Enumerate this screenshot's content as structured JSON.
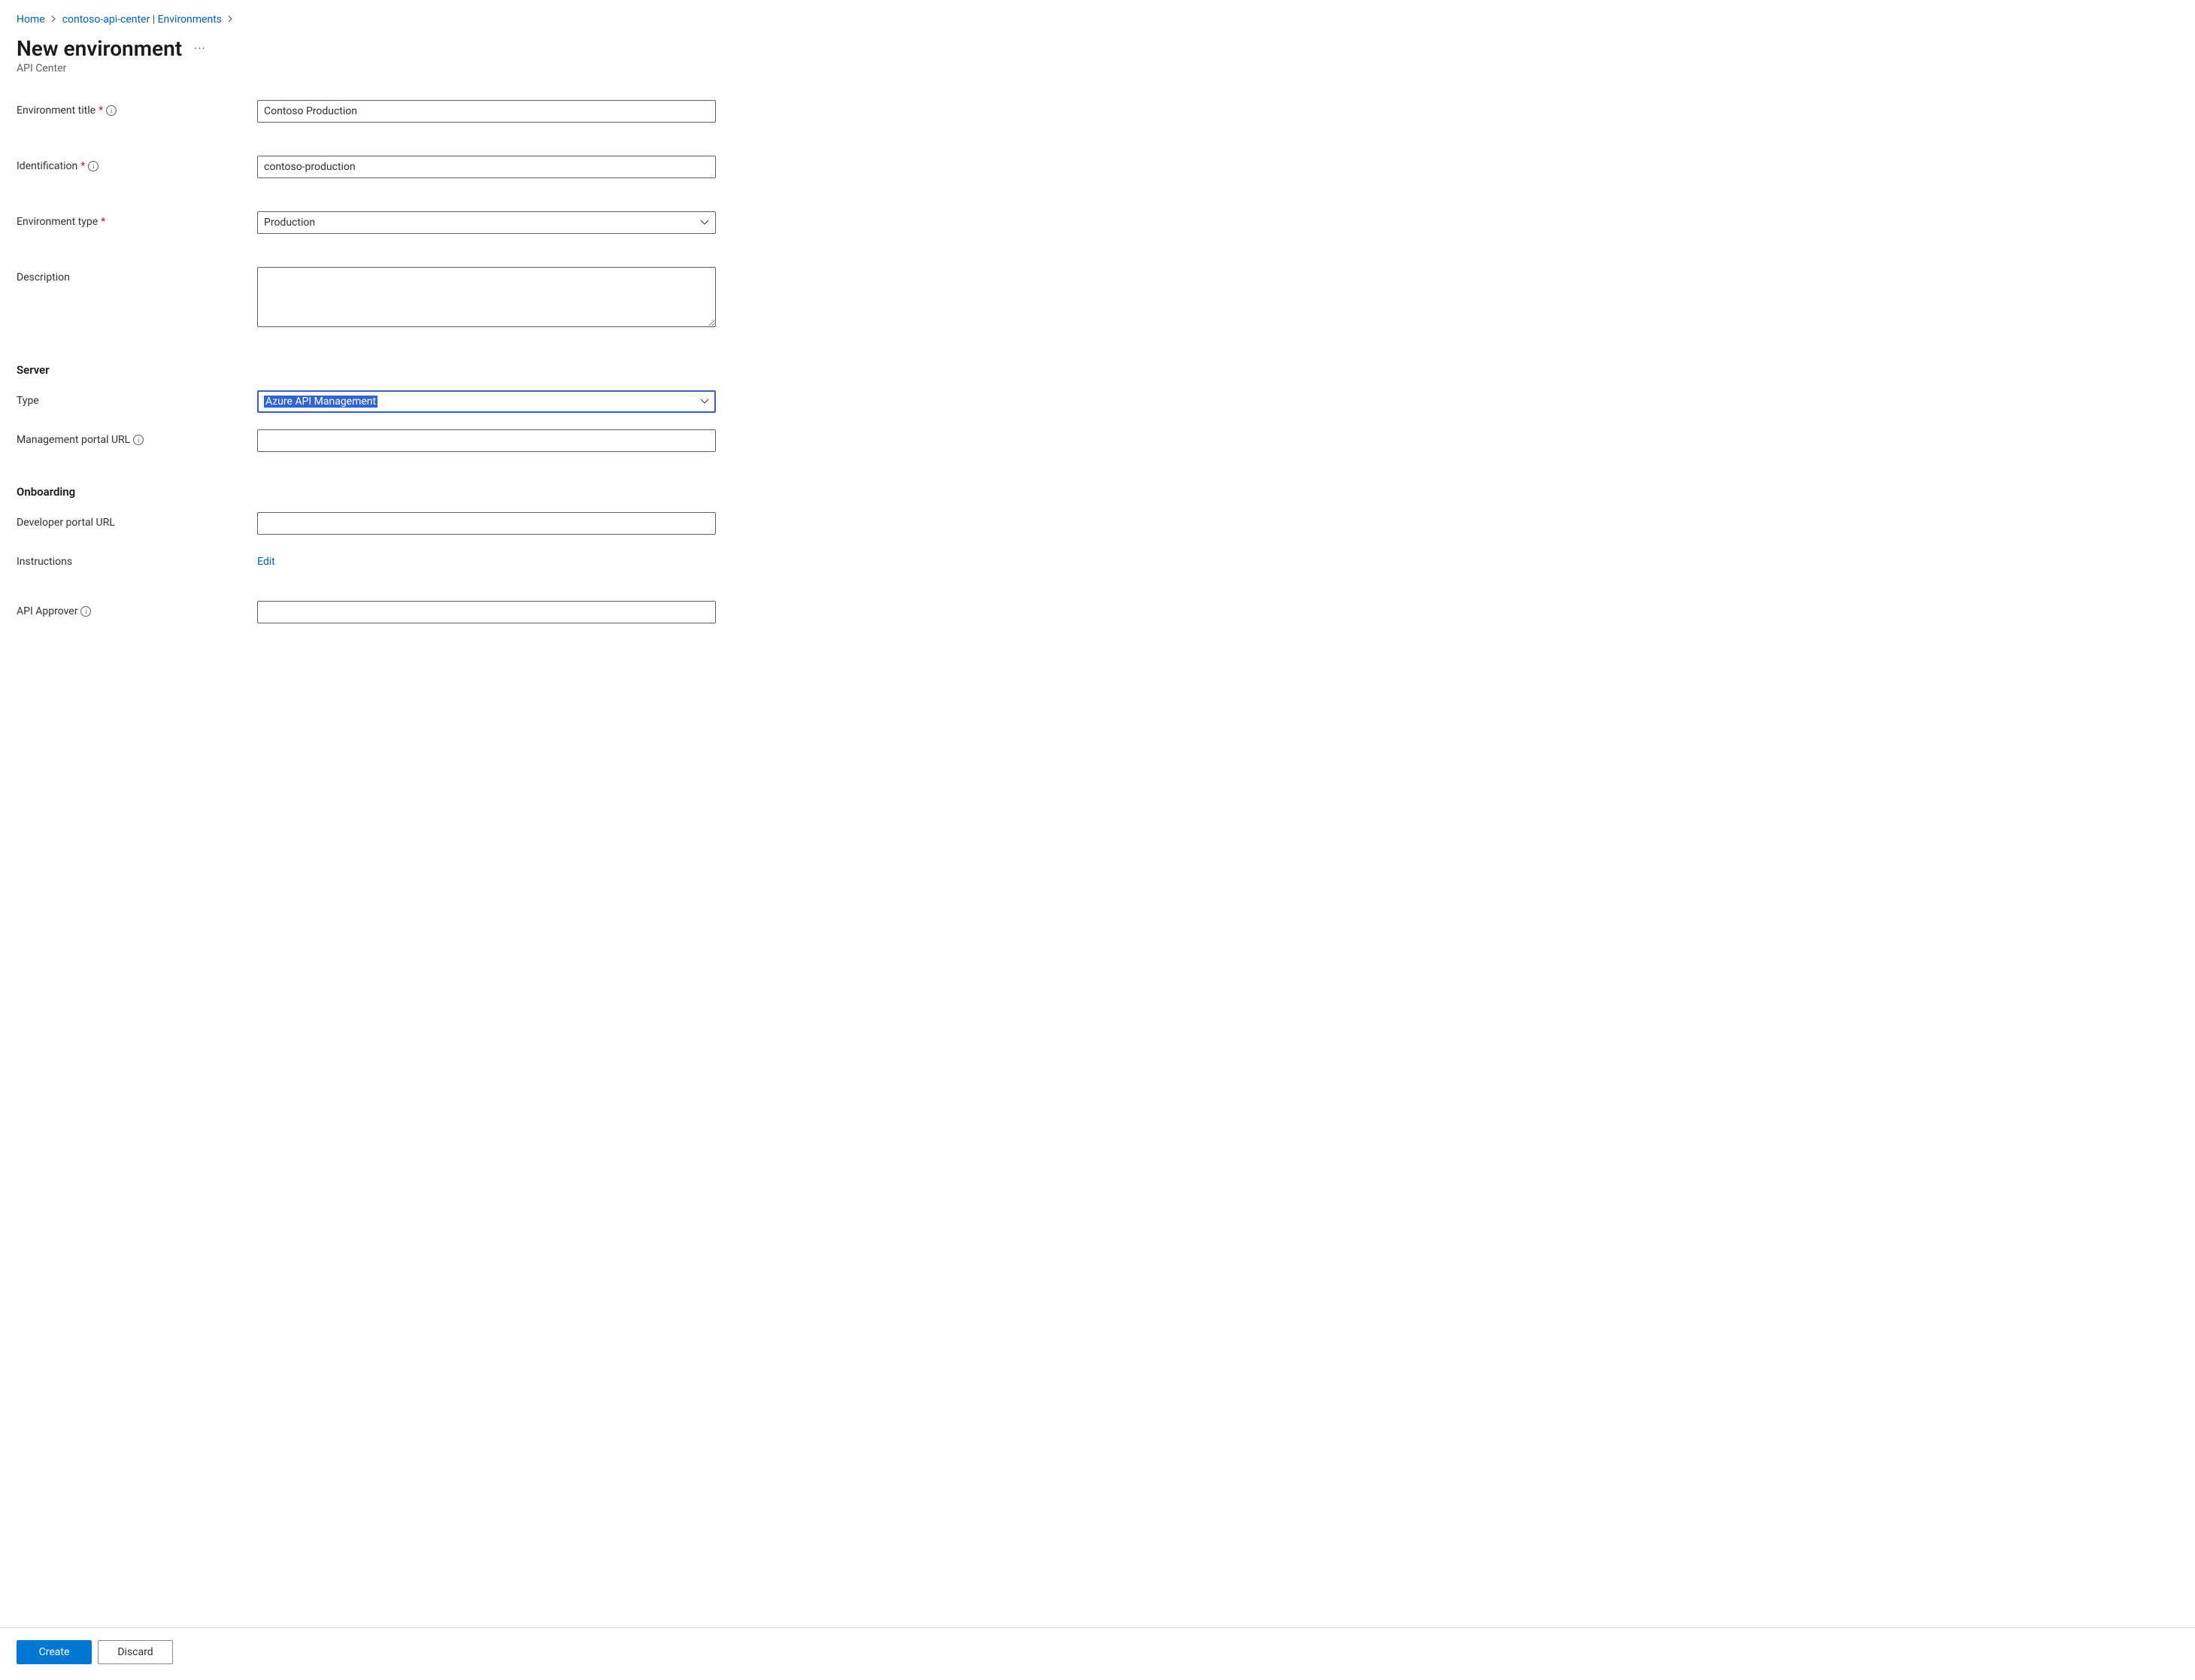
{
  "breadcrumb": {
    "home": "Home",
    "resource": "contoso-api-center | Environments"
  },
  "title": "New environment",
  "subtitle": "API Center",
  "form": {
    "env_title_label": "Environment title",
    "env_title_value": "Contoso Production",
    "identification_label": "Identification",
    "identification_value": "contoso-production",
    "env_type_label": "Environment type",
    "env_type_value": "Production",
    "description_label": "Description",
    "description_value": ""
  },
  "server": {
    "heading": "Server",
    "type_label": "Type",
    "type_value": "Azure API Management",
    "mgmt_url_label": "Management portal URL",
    "mgmt_url_value": ""
  },
  "onboarding": {
    "heading": "Onboarding",
    "dev_url_label": "Developer portal URL",
    "dev_url_value": "",
    "instructions_label": "Instructions",
    "instructions_action": "Edit",
    "approver_label": "API Approver",
    "approver_value": ""
  },
  "footer": {
    "create": "Create",
    "discard": "Discard"
  }
}
